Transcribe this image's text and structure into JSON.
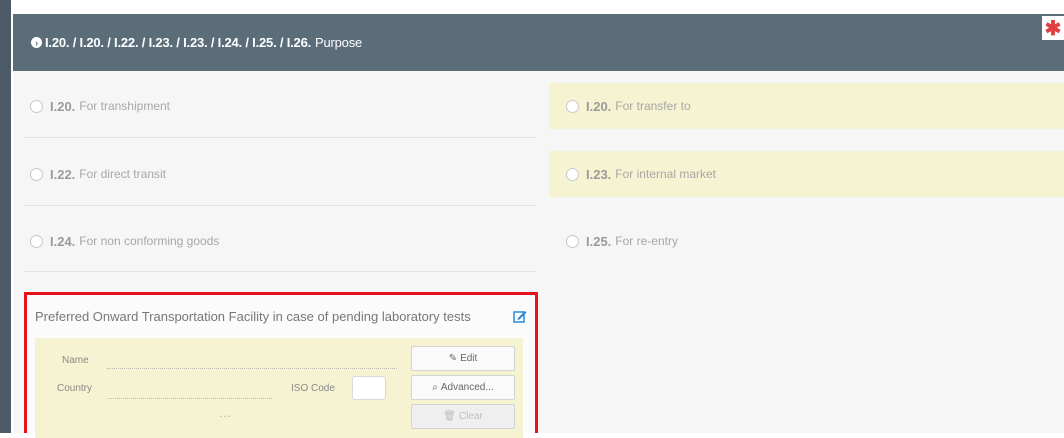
{
  "header": {
    "prefix": "I.20. / I.20. / I.22. / I.23. / I.23. / I.24. / I.25. / I.26.",
    "title": "Purpose",
    "required_mark": "✱"
  },
  "options": [
    {
      "code": "I.20.",
      "label": "For transhipment"
    },
    {
      "code": "I.20.",
      "label": "For transfer to"
    },
    {
      "code": "I.22.",
      "label": "For direct transit"
    },
    {
      "code": "I.23.",
      "label": "For internal market"
    },
    {
      "code": "I.24.",
      "label": "For non conforming goods"
    },
    {
      "code": "I.25.",
      "label": "For re-entry"
    }
  ],
  "panel": {
    "title": "Preferred Onward Transportation Facility in case of pending laboratory tests",
    "name_label": "Name",
    "country_label": "Country",
    "iso_label": "ISO Code",
    "more": "...",
    "buttons": {
      "edit": "Edit",
      "advanced": "Advanced...",
      "clear": "Clear"
    }
  },
  "colors": {
    "header_bg": "#5b6d78",
    "highlight": "#f6f3d2",
    "focus_border": "#e8131a"
  }
}
